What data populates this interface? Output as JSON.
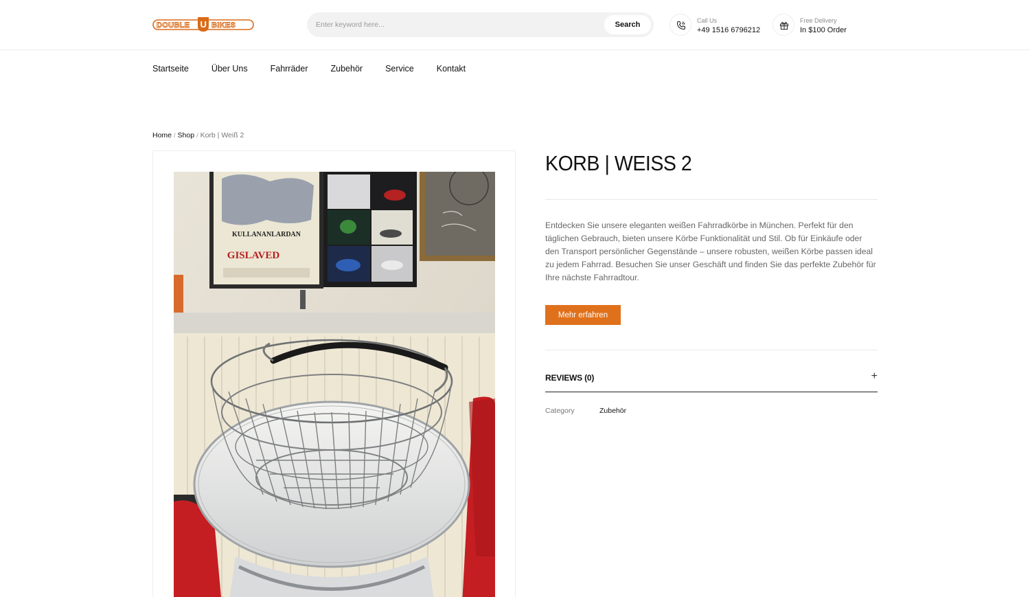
{
  "brand": {
    "logo_text": "DOUBLE U BIKES",
    "accent": "#e0711c"
  },
  "search": {
    "placeholder": "Enter keyword here...",
    "button": "Search"
  },
  "contact": {
    "call_label": "Call Us",
    "call_value": "+49 1516 6796212",
    "delivery_label": "Free Delivery",
    "delivery_value": "In $100 Order"
  },
  "nav": [
    "Startseite",
    "Über Uns",
    "Fahrräder",
    "Zubehör",
    "Service",
    "Kontakt"
  ],
  "breadcrumb": {
    "home": "Home",
    "shop": "Shop",
    "current": "Korb | Weiß 2",
    "separator": "/"
  },
  "product": {
    "title": "KORB | WEISS 2",
    "description": "Entdecken Sie unsere eleganten weißen Fahrradkörbe in München. Perfekt für den täglichen Gebrauch, bieten unsere Körbe Funktionalität und Stil. Ob für Einkäufe oder den Transport persönlicher Gegenstände – unsere robusten, weißen Körbe passen ideal zu jedem Fahrrad. Besuchen Sie unser Geschäft und finden Sie das perfekte Zubehör für Ihre nächste Fahrradtour.",
    "cta": "Mehr erfahren",
    "reviews_label": "REVIEWS (0)",
    "expand_symbol": "+",
    "category_label": "Category",
    "category_value": "Zubehör"
  },
  "photo": {
    "poster_line1": "KULLANANLARDAN",
    "poster_line2": "GISLAVED"
  }
}
